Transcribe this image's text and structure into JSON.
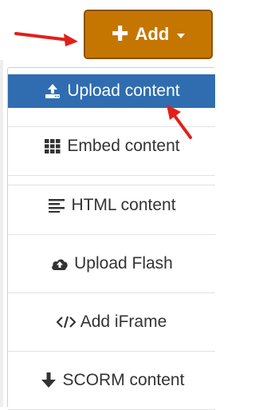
{
  "toolbar": {
    "add_label": "Add",
    "add_icon": "plus-icon",
    "caret_icon": "caret-down-icon",
    "accent_color": "#c57600"
  },
  "menu": {
    "active_color": "#2f6db0",
    "items": [
      {
        "label": "Upload content",
        "icon": "upload-icon",
        "active": true
      },
      {
        "label": "Embed content",
        "icon": "grid-icon",
        "active": false
      },
      {
        "label": "HTML content",
        "icon": "align-left-icon",
        "active": false
      },
      {
        "label": "Upload Flash",
        "icon": "cloud-upload-icon",
        "active": false
      },
      {
        "label": "Add iFrame",
        "icon": "code-icon",
        "active": false
      },
      {
        "label": "SCORM content",
        "icon": "arrow-down-icon",
        "active": false
      }
    ]
  },
  "annotations": {
    "arrow_color": "#e0201b"
  }
}
